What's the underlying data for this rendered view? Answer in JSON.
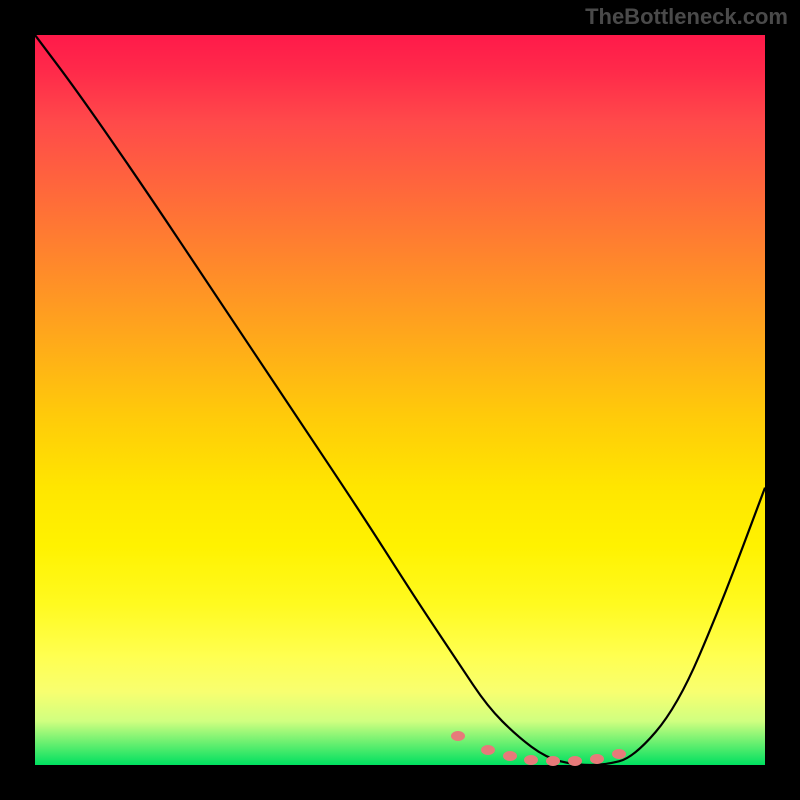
{
  "watermark": "TheBottleneck.com",
  "chart_data": {
    "type": "line",
    "title": "",
    "xlabel": "",
    "ylabel": "",
    "xlim": [
      0,
      100
    ],
    "ylim": [
      0,
      100
    ],
    "background_gradient": {
      "direction": "vertical",
      "stops": [
        {
          "pos": 0,
          "color": "#ff1a4a"
        },
        {
          "pos": 50,
          "color": "#ffca0a"
        },
        {
          "pos": 85,
          "color": "#ffff50"
        },
        {
          "pos": 100,
          "color": "#00e060"
        }
      ]
    },
    "series": [
      {
        "name": "bottleneck-curve",
        "x": [
          0,
          6,
          15,
          25,
          35,
          45,
          52,
          58,
          62,
          66,
          70,
          74,
          78,
          82,
          88,
          94,
          100
        ],
        "values": [
          100,
          92,
          79,
          64,
          49,
          34,
          23,
          14,
          8,
          4,
          1,
          0,
          0,
          1,
          8,
          22,
          38
        ]
      }
    ],
    "markers": {
      "x": [
        58,
        62,
        65,
        68,
        71,
        74,
        77,
        80
      ],
      "values": [
        4,
        2,
        1.2,
        0.7,
        0.5,
        0.5,
        0.8,
        1.5
      ]
    }
  }
}
